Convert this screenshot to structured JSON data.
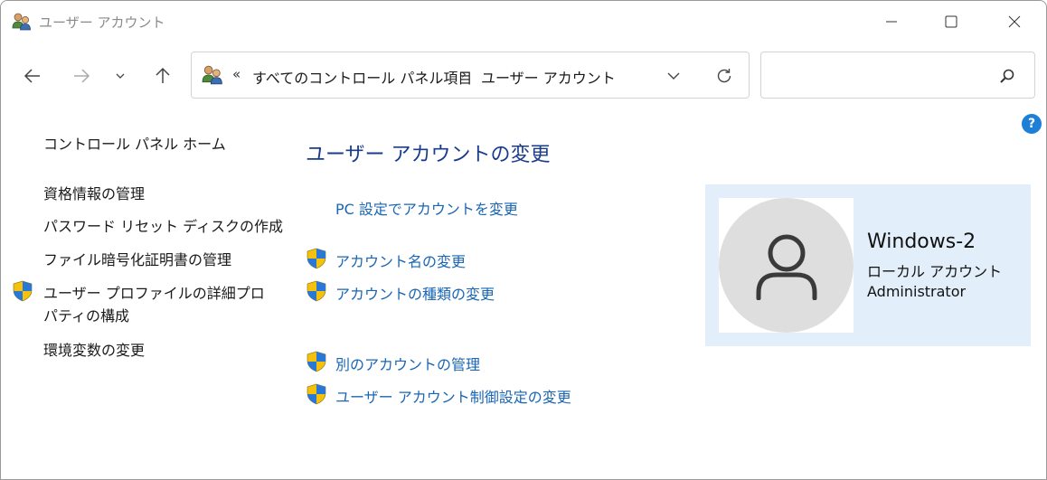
{
  "window": {
    "title": "ユーザー アカウント"
  },
  "address": {
    "overflow": "«",
    "crumbs": [
      "すべてのコントロール パネル項目",
      "ユーザー アカウント"
    ],
    "separator": "›"
  },
  "search": {
    "value": "",
    "placeholder": ""
  },
  "help": {
    "label": "?"
  },
  "sidebar": {
    "home": "コントロール パネル ホーム",
    "items": [
      "資格情報の管理",
      "パスワード リセット ディスクの作成",
      "ファイル暗号化証明書の管理",
      "ユーザー プロファイルの詳細プロパティの構成",
      "環境変数の変更"
    ]
  },
  "main": {
    "heading": "ユーザー アカウントの変更",
    "tasks": [
      "PC 設定でアカウントを変更",
      "アカウント名の変更",
      "アカウントの種類の変更",
      "別のアカウントの管理",
      "ユーザー アカウント制御設定の変更"
    ]
  },
  "user": {
    "name": "Windows-2",
    "account_type": "ローカル アカウント",
    "role": "Administrator"
  },
  "colors": {
    "link": "#1a66b5",
    "heading": "#1a3c8c",
    "card_bg": "#e2effa",
    "help": "#1e7fd6"
  },
  "icons": [
    "users-icon",
    "back-arrow-icon",
    "forward-arrow-icon",
    "chevron-down-icon",
    "up-arrow-icon",
    "refresh-icon",
    "search-icon",
    "help-icon",
    "uac-shield-icon",
    "user-avatar-icon"
  ]
}
